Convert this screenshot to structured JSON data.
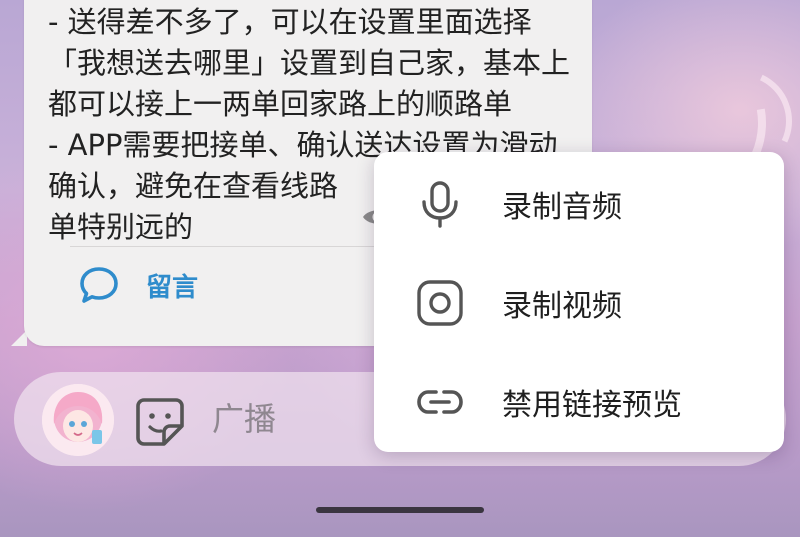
{
  "message": {
    "lines": [
      "- 送得差不多了，可以在设置里面选择",
      "「我想送去哪里」设置到自己家，基本上",
      "都可以接上一两单回家路上的顺路单",
      "- APP需要把接单、确认送达设置为滑动",
      "确认，避免在查看线路",
      "单特别远的"
    ],
    "comment_label": "留言"
  },
  "input": {
    "placeholder": "广播"
  },
  "menu": {
    "items": [
      {
        "label": "录制音频",
        "icon": "microphone-icon"
      },
      {
        "label": "录制视频",
        "icon": "camera-icon"
      },
      {
        "label": "禁用链接预览",
        "icon": "link-icon"
      }
    ]
  },
  "colors": {
    "accent": "#2f8ccc",
    "bubble": "#f1f0f0",
    "menu_bg": "#ffffff",
    "icon_gray": "#555555"
  }
}
